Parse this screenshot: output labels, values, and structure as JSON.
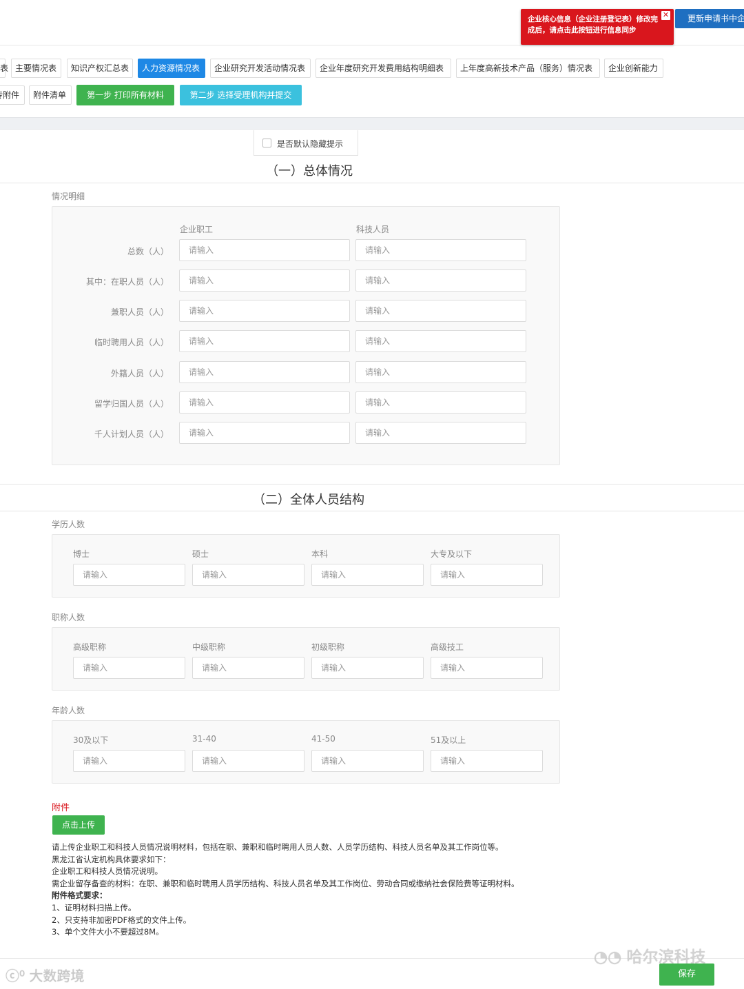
{
  "alert": {
    "text": "企业核心信息（企业注册登记表）修改完成后，请点击此按钮进行信息同步",
    "close_label": "✕"
  },
  "sync_button": "更新申请书中企",
  "tabs_row1": [
    "表",
    "主要情况表",
    "知识产权汇总表",
    "人力资源情况表",
    "企业研究开发活动情况表",
    "企业年度研究开发费用结构明细表",
    "上年度高新技术产品（服务）情况表",
    "企业创新能力"
  ],
  "tabs_row2": [
    "传附件",
    "附件清单"
  ],
  "step1_button": "第一步 打印所有材料",
  "step2_button": "第二步 选择受理机构并提交",
  "hide_hint_label": "是否默认隐藏提示",
  "section1": {
    "title": "（一）总体情况",
    "group_label": "情况明细",
    "col_headers": [
      "企业职工",
      "科技人员"
    ],
    "rows": [
      "总数（人）",
      "其中：在职人员（人）",
      "兼职人员（人）",
      "临时聘用人员（人）",
      "外籍人员（人）",
      "留学归国人员（人）",
      "千人计划人员（人）"
    ]
  },
  "placeholder": "请输入",
  "section2": {
    "title": "（二）全体人员结构",
    "groups": [
      {
        "label": "学历人数",
        "fields": [
          "博士",
          "硕士",
          "本科",
          "大专及以下"
        ]
      },
      {
        "label": "职称人数",
        "fields": [
          "高级职称",
          "中级职称",
          "初级职称",
          "高级技工"
        ]
      },
      {
        "label": "年龄人数",
        "fields": [
          "30及以下",
          "31-40",
          "41-50",
          "51及以上"
        ]
      }
    ]
  },
  "attachment": {
    "title": "附件",
    "upload_button": "点击上传",
    "notes": [
      "请上传企业职工和科技人员情况说明材料，包括在职、兼职和临时聘用人员人数、人员学历结构、科技人员名单及其工作岗位等。",
      "黑龙江省认定机构具体要求如下：",
      "企业职工和科技人员情况说明。",
      "需企业留存备查的材料：在职、兼职和临时聘用人员学历结构、科技人员名单及其工作岗位、劳动合同或缴纳社会保险费等证明材料。",
      "附件格式要求：",
      "1、证明材料扫描上传。",
      "2、只支持非加密PDF格式的文件上传。",
      "3、单个文件大小不要超过8M。"
    ]
  },
  "watermark_left": "大数跨境",
  "watermark_right": "哈尔滨科技",
  "save_button": "保存",
  "colors": {
    "alert": "#d9161d",
    "primary": "#1e88e5",
    "success": "#3fb34f",
    "info": "#3bc1de"
  }
}
